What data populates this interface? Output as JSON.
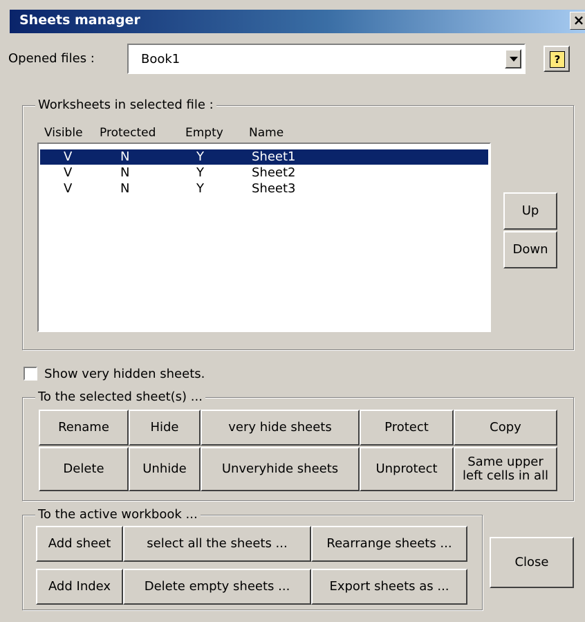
{
  "window": {
    "title": "Sheets manager",
    "close_glyph": "×"
  },
  "opened_files": {
    "label": "Opened files :",
    "value": "Book1"
  },
  "help": {
    "glyph": "?"
  },
  "worksheets": {
    "legend": "Worksheets in selected file :",
    "columns": [
      "Visible",
      "Protected",
      "Empty",
      "Name"
    ],
    "rows": [
      {
        "visible": "V",
        "protected": "N",
        "empty": "Y",
        "name": "Sheet1",
        "selected": true
      },
      {
        "visible": "V",
        "protected": "N",
        "empty": "Y",
        "name": "Sheet2",
        "selected": false
      },
      {
        "visible": "V",
        "protected": "N",
        "empty": "Y",
        "name": "Sheet3",
        "selected": false
      }
    ],
    "up_label": "Up",
    "down_label": "Down"
  },
  "show_hidden": {
    "label": "Show very hidden sheets.",
    "checked": false
  },
  "selected_sheets": {
    "legend": "To the selected sheet(s) ...",
    "buttons": {
      "rename": "Rename",
      "hide": "Hide",
      "very_hide": "very hide sheets",
      "protect": "Protect",
      "copy": "Copy",
      "delete": "Delete",
      "unhide": "Unhide",
      "unveryhide": "Unveryhide sheets",
      "unprotect": "Unprotect",
      "same_upper_1": "Same upper",
      "same_upper_2": "left cells in all"
    }
  },
  "active_workbook": {
    "legend": "To the active workbook ...",
    "buttons": {
      "add_sheet": "Add sheet",
      "select_all": "select all the sheets ...",
      "rearrange": "Rearrange sheets ...",
      "add_index": "Add Index",
      "delete_empty": "Delete empty sheets ...",
      "export": "Export sheets as ..."
    }
  },
  "close_label": "Close",
  "colors": {
    "face": "#d4d0c8",
    "title_start": "#0a246a",
    "selection": "#0a246a"
  }
}
